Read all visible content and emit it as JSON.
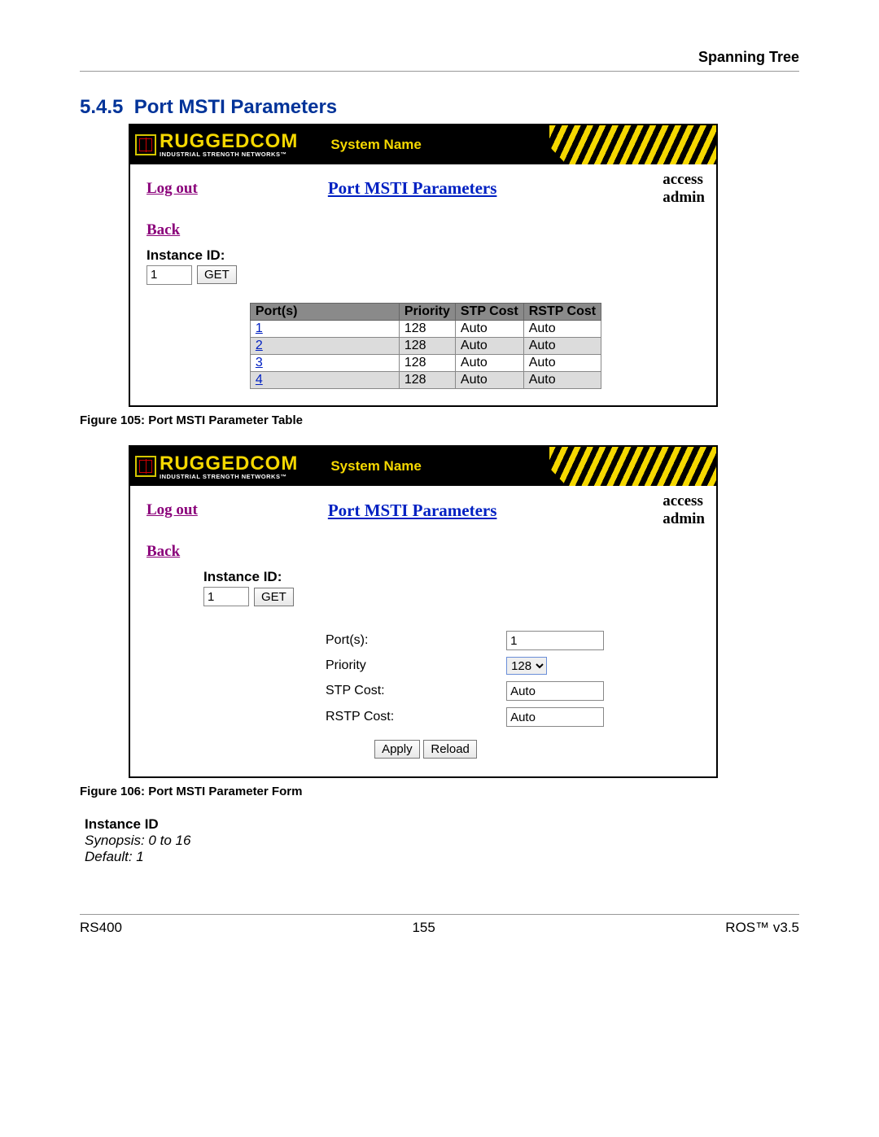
{
  "doc": {
    "chapter_header": "Spanning Tree",
    "section_number": "5.4.5",
    "section_title": "Port MSTI Parameters",
    "caption1": "Figure 105: Port MSTI Parameter Table",
    "caption2": "Figure 106: Port MSTI Parameter Form",
    "param_name": "Instance ID",
    "synopsis": "Synopsis: 0 to 16",
    "default": "Default: 1",
    "footer_left": "RS400",
    "footer_center": "155",
    "footer_right": "ROS™  v3.5"
  },
  "brand": {
    "name": "RUGGEDCOM",
    "tagline": "INDUSTRIAL STRENGTH NETWORKS™",
    "sys_label": "System Name"
  },
  "panel1": {
    "logout": "Log out",
    "title": "Port MSTI Parameters",
    "access1": "access",
    "access2": "admin",
    "back": "Back",
    "instance_label": "Instance ID:",
    "instance_value": "1",
    "get": "GET",
    "headers": {
      "ports": "Port(s)",
      "priority": "Priority",
      "stp": "STP Cost",
      "rstp": "RSTP Cost"
    },
    "rows": [
      {
        "port": "1",
        "priority": "128",
        "stp": "Auto",
        "rstp": "Auto"
      },
      {
        "port": "2",
        "priority": "128",
        "stp": "Auto",
        "rstp": "Auto"
      },
      {
        "port": "3",
        "priority": "128",
        "stp": "Auto",
        "rstp": "Auto"
      },
      {
        "port": "4",
        "priority": "128",
        "stp": "Auto",
        "rstp": "Auto"
      }
    ]
  },
  "panel2": {
    "logout": "Log out",
    "title": "Port MSTI Parameters",
    "access1": "access",
    "access2": "admin",
    "back": "Back",
    "instance_label": "Instance ID:",
    "instance_value": "1",
    "get": "GET",
    "form": {
      "ports_label": "Port(s):",
      "ports_value": "1",
      "priority_label": "Priority",
      "priority_value": "128",
      "stp_label": "STP Cost:",
      "stp_value": "Auto",
      "rstp_label": "RSTP Cost:",
      "rstp_value": "Auto",
      "apply": "Apply",
      "reload": "Reload"
    }
  }
}
